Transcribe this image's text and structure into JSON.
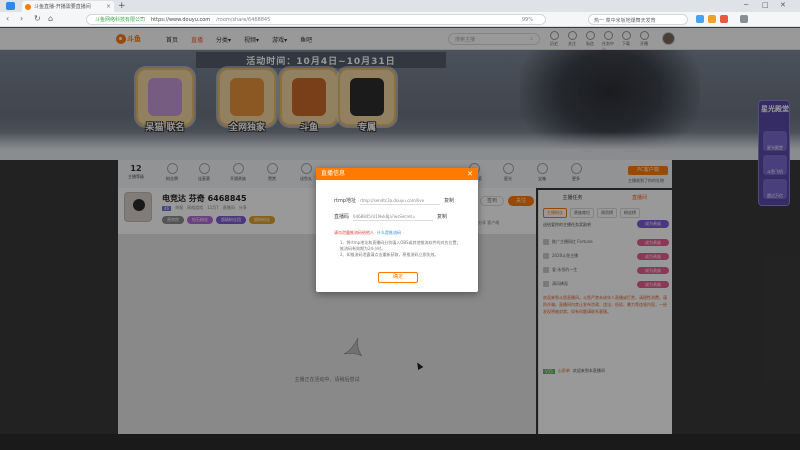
{
  "browser": {
    "tab_title": "斗鱼直播-开播需要直播间",
    "new_tab": "+",
    "url_site": "斗鱼网络科技有限公司",
    "url_host": "https://www.douyu.com",
    "url_path": "/room/share/6468845",
    "zoom": "99%",
    "search_text": "热一 菜中米坂地爆舞天发育",
    "win_min": "─",
    "win_max": "□",
    "win_close": "✕"
  },
  "header": {
    "logo_text": "斗鱼",
    "nav": [
      "首页",
      "直播",
      "分类▾",
      "视频▾",
      "游戏▾",
      "鱼吧"
    ],
    "search_placeholder": "搜索主播",
    "icons": [
      "历史",
      "关注",
      "私信",
      "任务中心",
      "下载",
      "开播"
    ]
  },
  "banner": {
    "event_title": "活动时间：10月4日~10月31日",
    "prizes": [
      "呆猫 联名",
      "全网独家",
      "斗鱼",
      "专属"
    ],
    "side_title": "星光殿堂",
    "side_cells": [
      "星光殿堂",
      "斗鱼飞机",
      "超过万亿"
    ]
  },
  "gifts": {
    "count": "12",
    "items": [
      "主播等级",
      "粉丝牌",
      "连麦赛",
      "开通贵族",
      "赞赏",
      "送鱼丸",
      "鱼粮",
      "星光",
      "活动",
      "活动",
      "宝箱"
    ],
    "right_items": [
      "直播抽奖",
      "更多"
    ],
    "pc_button": "PC客户端",
    "pc_sub": "主播收到了你的礼物"
  },
  "streamer": {
    "name": "电竞达 芬奇 6468845",
    "level": "46",
    "meta": [
      "举报",
      "网络游戏",
      "直播间",
      "分享"
    ],
    "fans": "11月7",
    "tags": [
      "贵宾房",
      "钻石粉丝",
      "超级粉丝团",
      "超粉粉丝"
    ],
    "share": "分享  客户端",
    "sign": "签到",
    "follow": "关注"
  },
  "video": {
    "loading_text": "主播正在活动中，请稍后尝试"
  },
  "chat": {
    "tabs": [
      "主播任务",
      "直播间"
    ],
    "sub_tabs": [
      "主播粉丝",
      "贵族席位",
      "周贡榜",
      "粉丝榜"
    ],
    "list_head": "送给爱你的主播任务奖励吧",
    "list_button": "成为贵族",
    "rows": [
      {
        "name": "推广主播网红 Fortune",
        "badge": "成为贵族"
      },
      {
        "name": "2020斗鱼主播",
        "badge": "成为贵族"
      },
      {
        "name": "爱·永恒的一生",
        "badge": "成为贵族"
      },
      {
        "name": "清风拂面",
        "badge": "成为贵族"
      }
    ],
    "notice": "欢迎来到斗鱼直播间。斗鱼严禁未成年人直播或打赏，请理性消费，谨防诈骗。直播间内禁止发布涉政、违法、低俗、暴力等违规内容，一经发现将被封禁。如有问题请联系客服。",
    "bottom_tag": "V15",
    "bottom_link": "心愿单",
    "bottom_text": "欢迎来到本直播间"
  },
  "dialog": {
    "title": "直播信息",
    "close": "✕",
    "field1_label": "rtmp地址",
    "field1_value": "rtmp://sendtc3a.douyu.com/live",
    "field1_copy": "复制",
    "field2_label": "直播码",
    "field2_value": "6468845rU1Nvk8Ja?wsSecret=",
    "field2_copy": "复制",
    "warn": "请勿泄露推流码给他人",
    "warn_link": "什么是推流码",
    "tips": [
      "1、将rtmp地址和直播码分别填入OBS或其他推流软件的对应位置；推流码有效期为24小时。",
      "2、如推流码泄露请点击重新获取，原推流码立即失效。"
    ],
    "ok": "确定"
  },
  "colors": {
    "accent": "#ff7a00",
    "brand_red": "#ff5d23",
    "purple": "#5a4aa8"
  }
}
